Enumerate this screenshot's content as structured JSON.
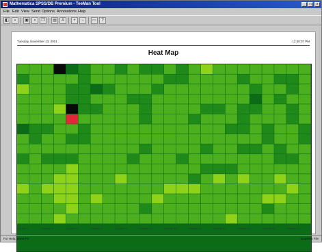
{
  "window": {
    "title": "Mathematica SPSS/DB Premium - TeeMan Tool",
    "controls": [
      "_",
      "□",
      "x"
    ]
  },
  "menu": [
    "File",
    "Edit",
    "View",
    "Send",
    "Options",
    "Annotations",
    "Help"
  ],
  "toolbar": {
    "buttons": [
      "open-icon",
      "save-icon",
      "print-icon",
      "zoom-icon",
      "copy-icon",
      "paste-icon",
      "text-icon",
      "zoom-in-icon",
      "zoom-out-icon",
      "page-icon",
      "help-icon"
    ]
  },
  "report": {
    "date": "Tuesday, November 13, 2001",
    "time": "12:30:07 PM",
    "title": "Heat Map"
  },
  "status": {
    "left": "For Help, press F1",
    "right": "Graphics File"
  },
  "colors": {
    "high": "#0a0a0a",
    "alert": "#e0283a",
    "dark_green": "#0b6b16",
    "mid_green": "#3a9e1e",
    "light_green": "#8ed21a"
  },
  "chart_data": {
    "type": "heatmap",
    "title": "Heat Map",
    "columns": [
      "Column 1",
      "Column 3",
      "Column 5",
      "Column 7",
      "Column 9",
      "Column 11",
      "Column 13",
      "Column 15",
      "Column 17",
      "Column 19",
      "Column 21",
      "Column 23"
    ],
    "rows": 16,
    "cols": 24,
    "values": [
      [
        2,
        2,
        2,
        4,
        0,
        1,
        2,
        2,
        1,
        2,
        1,
        1,
        2,
        1,
        2,
        3,
        2,
        2,
        2,
        2,
        2,
        2,
        2,
        2
      ],
      [
        1,
        2,
        2,
        2,
        2,
        1,
        2,
        2,
        2,
        2,
        2,
        2,
        1,
        1,
        2,
        2,
        2,
        2,
        1,
        2,
        2,
        1,
        1,
        2
      ],
      [
        3,
        2,
        2,
        2,
        1,
        1,
        0,
        1,
        2,
        2,
        2,
        1,
        2,
        2,
        2,
        2,
        2,
        2,
        2,
        1,
        2,
        2,
        1,
        2
      ],
      [
        2,
        2,
        2,
        2,
        1,
        1,
        2,
        2,
        2,
        1,
        1,
        2,
        2,
        2,
        2,
        2,
        2,
        2,
        2,
        0,
        2,
        1,
        2,
        2
      ],
      [
        2,
        2,
        2,
        3,
        4,
        1,
        1,
        2,
        2,
        2,
        1,
        2,
        2,
        2,
        2,
        1,
        1,
        2,
        1,
        1,
        2,
        2,
        1,
        2
      ],
      [
        2,
        2,
        2,
        2,
        5,
        2,
        2,
        2,
        2,
        2,
        1,
        2,
        2,
        2,
        1,
        2,
        2,
        2,
        1,
        2,
        2,
        2,
        1,
        2
      ],
      [
        0,
        1,
        1,
        2,
        2,
        1,
        2,
        2,
        2,
        2,
        2,
        2,
        2,
        2,
        2,
        2,
        2,
        1,
        1,
        2,
        1,
        2,
        2,
        1
      ],
      [
        2,
        1,
        2,
        2,
        1,
        1,
        2,
        2,
        2,
        2,
        2,
        2,
        2,
        2,
        2,
        2,
        2,
        2,
        2,
        2,
        1,
        2,
        2,
        1
      ],
      [
        2,
        2,
        2,
        2,
        2,
        2,
        2,
        2,
        2,
        2,
        1,
        2,
        2,
        2,
        2,
        1,
        2,
        2,
        1,
        1,
        2,
        1,
        2,
        2
      ],
      [
        1,
        2,
        1,
        1,
        1,
        2,
        2,
        2,
        2,
        1,
        2,
        2,
        2,
        1,
        2,
        2,
        2,
        2,
        2,
        2,
        2,
        1,
        1,
        2
      ],
      [
        2,
        2,
        2,
        2,
        3,
        2,
        2,
        2,
        2,
        2,
        2,
        2,
        2,
        2,
        2,
        1,
        1,
        1,
        2,
        2,
        2,
        2,
        2,
        2
      ],
      [
        2,
        2,
        2,
        3,
        3,
        2,
        2,
        2,
        3,
        2,
        2,
        2,
        2,
        2,
        1,
        2,
        3,
        2,
        3,
        2,
        2,
        3,
        2,
        2
      ],
      [
        3,
        2,
        3,
        3,
        3,
        2,
        2,
        2,
        2,
        2,
        2,
        2,
        3,
        3,
        3,
        2,
        2,
        2,
        2,
        2,
        2,
        2,
        3,
        2
      ],
      [
        2,
        2,
        2,
        3,
        3,
        2,
        3,
        2,
        2,
        2,
        2,
        3,
        2,
        2,
        2,
        2,
        2,
        2,
        2,
        2,
        3,
        3,
        2,
        2
      ],
      [
        2,
        2,
        2,
        2,
        3,
        2,
        2,
        2,
        2,
        2,
        1,
        2,
        2,
        2,
        2,
        2,
        2,
        2,
        2,
        2,
        1,
        2,
        2,
        2
      ],
      [
        2,
        2,
        2,
        3,
        2,
        2,
        2,
        2,
        2,
        2,
        2,
        2,
        2,
        2,
        2,
        2,
        2,
        3,
        2,
        2,
        2,
        2,
        2,
        2
      ]
    ],
    "color_scale": {
      "0": "#0b6b16",
      "1": "#1f8a1a",
      "2": "#4caf1e",
      "3": "#8ed21a",
      "4": "#0a0a0a",
      "5": "#e0283a"
    }
  }
}
